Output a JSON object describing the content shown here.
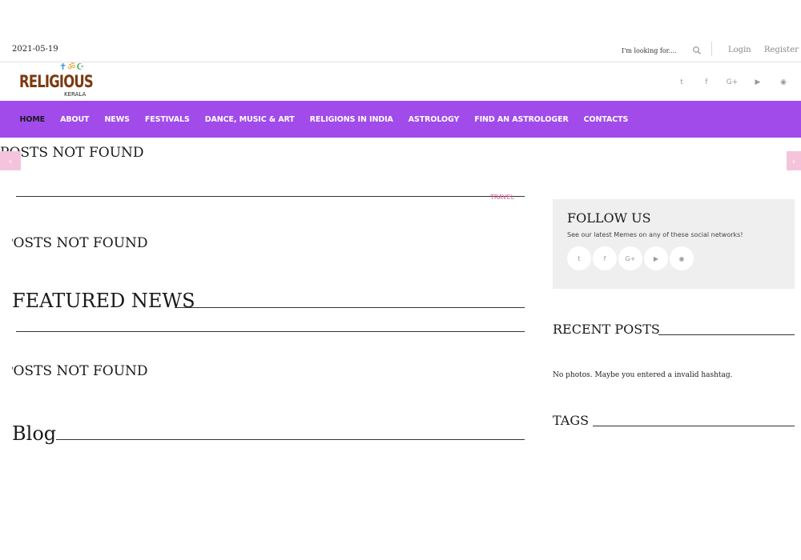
{
  "topbar": {
    "date": "2021-05-19",
    "search_placeholder": "I'm looking for....",
    "login": "Login",
    "register": "Register"
  },
  "logo": {
    "word": "RELIGIOUS",
    "sub": "KERALA",
    "symbols": [
      "✝",
      "ॐ",
      "☪"
    ]
  },
  "social": {
    "twitter": "t",
    "facebook": "f",
    "googleplus": "G+",
    "youtube": "▶",
    "rss": "◉"
  },
  "nav": {
    "items": [
      {
        "label": "HOME",
        "active": true
      },
      {
        "label": "ABOUT"
      },
      {
        "label": "NEWS"
      },
      {
        "label": "FESTIVALS"
      },
      {
        "label": "DANCE, MUSIC & ART"
      },
      {
        "label": "RELIGIONS IN INDIA"
      },
      {
        "label": "ASTROLOGY"
      },
      {
        "label": "FIND AN ASTROLOGER"
      },
      {
        "label": "CONTACTS"
      }
    ]
  },
  "main": {
    "slider_notfound": "POSTS NOT FOUND",
    "slider_prev": "‹",
    "slider_next": "›",
    "category_tag": "TRAVEL",
    "notfound_2": "POSTS NOT FOUND",
    "featured_title": "FEATURED NEWS",
    "notfound_3": "POSTS NOT FOUND",
    "blog_title": "Blog"
  },
  "sidebar": {
    "follow_title": "FOLLOW US",
    "follow_text": "See our latest Memes on any of these social networks!",
    "recent_title": "RECENT POSTS",
    "no_photos": "No photos. Maybe you entered a invalid hashtag.",
    "tags_title": "TAGS"
  },
  "colors": {
    "nav_bg": "#a14bea",
    "accent_pink": "#e0609c",
    "slider_arrow_bg": "#f5c4dc"
  }
}
